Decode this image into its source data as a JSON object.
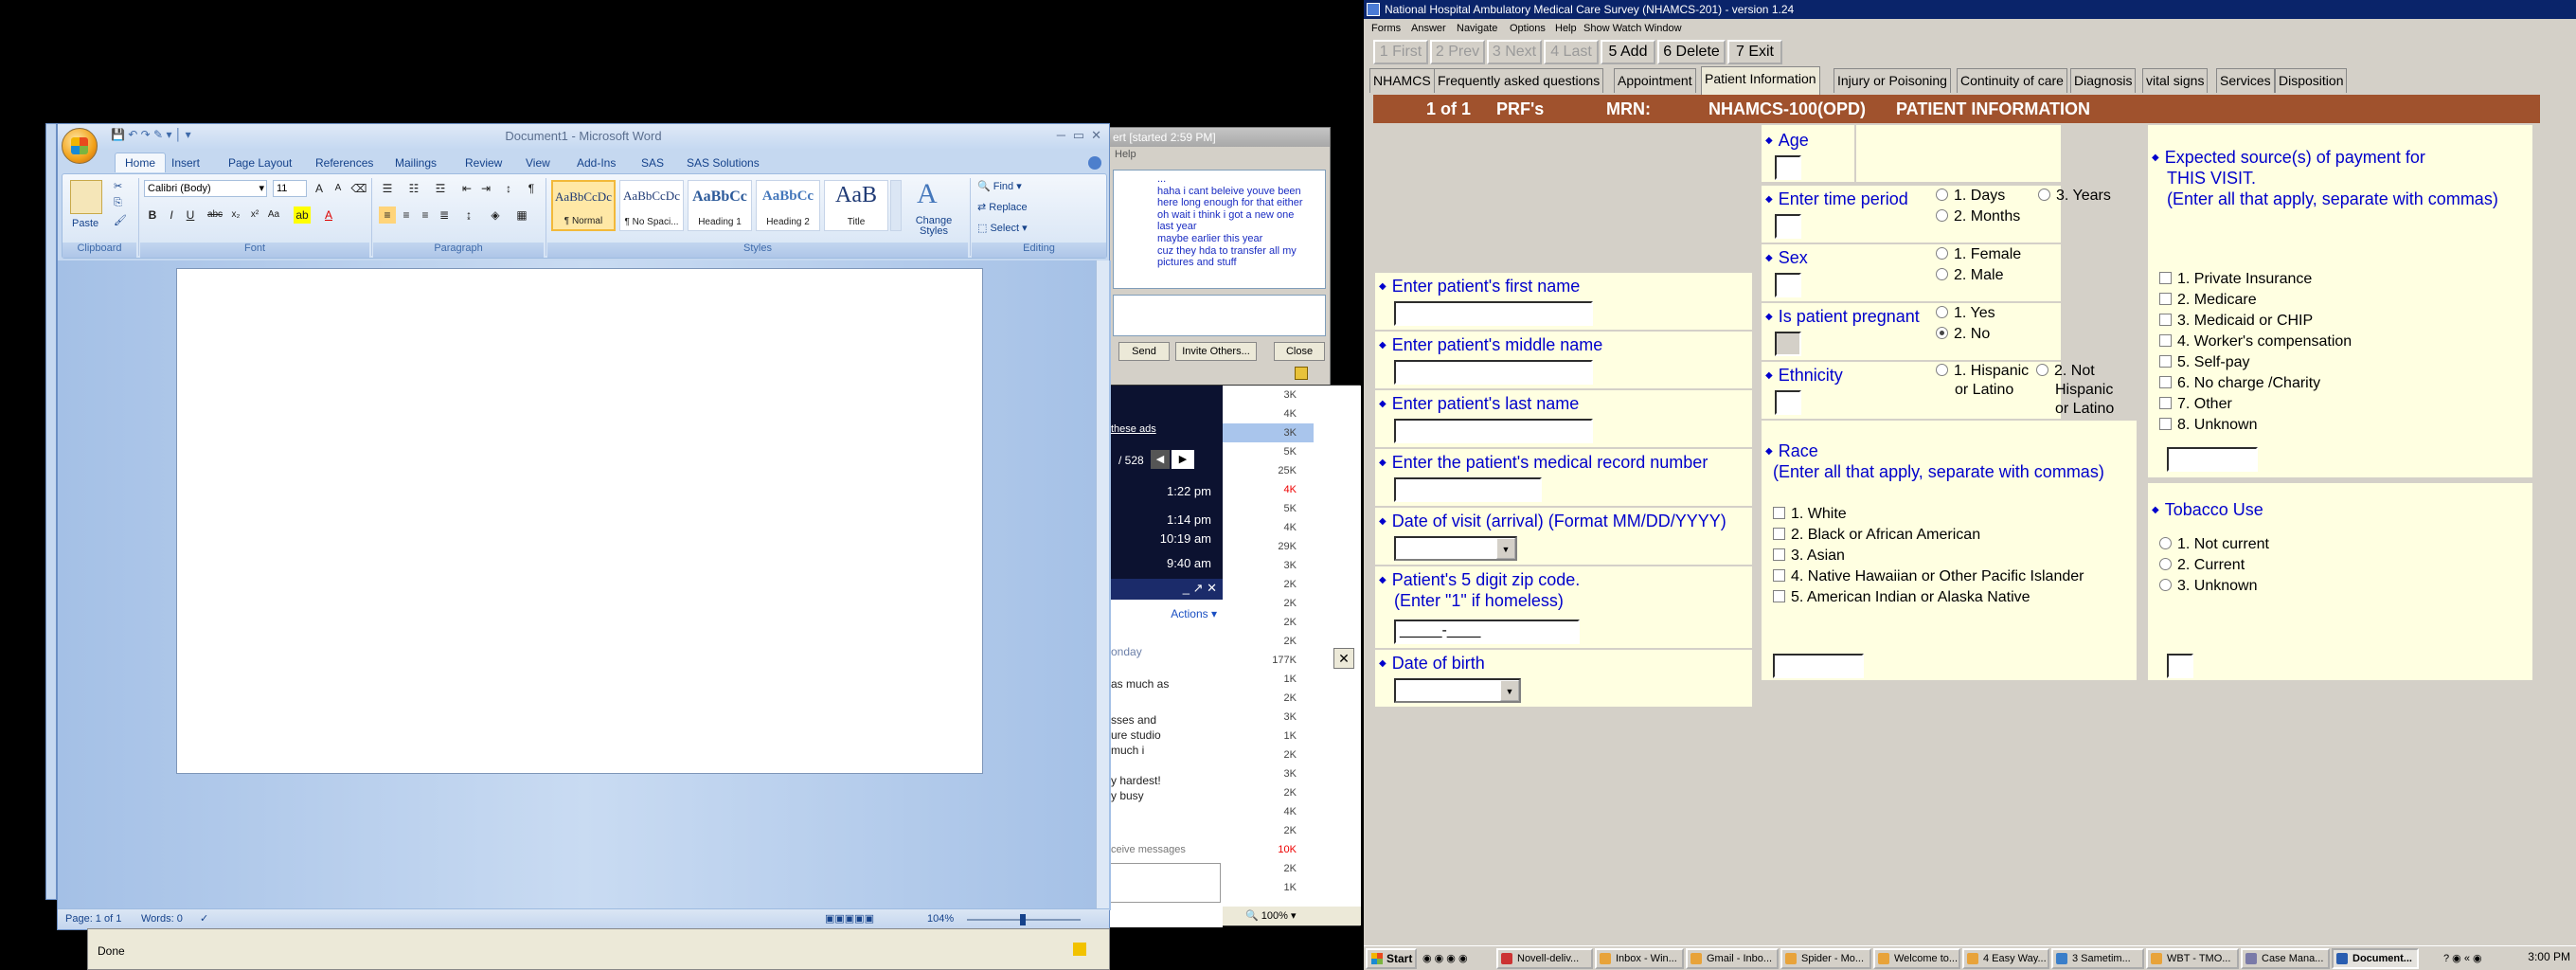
{
  "word": {
    "title": "Document1 - Microsoft Word",
    "tabs": [
      "Home",
      "Insert",
      "Page Layout",
      "References",
      "Mailings",
      "Review",
      "View",
      "Add-Ins",
      "SAS",
      "SAS Solutions"
    ],
    "font_name": "Calibri (Body)",
    "font_size": "11",
    "paste_label": "Paste",
    "groups": [
      "Clipboard",
      "Font",
      "Paragraph",
      "Styles",
      "Editing"
    ],
    "styles": [
      {
        "sample": "AaBbCcDc",
        "caption": "¶ Normal"
      },
      {
        "sample": "AaBbCcDc",
        "caption": "¶ No Spaci..."
      },
      {
        "sample": "AaBbCc",
        "caption": "Heading 1"
      },
      {
        "sample": "AaBbCc",
        "caption": "Heading 2"
      },
      {
        "sample": "AaB",
        "caption": "Title"
      }
    ],
    "change_styles": "Change Styles",
    "editing": {
      "find": "Find",
      "replace": "Replace",
      "select": "Select"
    },
    "status": {
      "page": "Page: 1 of 1",
      "words": "Words: 0",
      "zoom": "104%"
    }
  },
  "chat": {
    "title": "ert [started 2:59 PM]",
    "menu": "Help",
    "messages": [
      "...",
      "haha i cant beleive youve been",
      "here long enough for that either",
      "oh wait i think i got a new one",
      "last year",
      "maybe earlier this year",
      "cuz they hda to transfer all my",
      "pictures and stuff"
    ],
    "send": "Send",
    "invite": "Invite Others...",
    "close": "Close"
  },
  "mail": {
    "links": "these ads",
    "counter": "/ 528",
    "times": [
      "1:22 pm",
      "1:14 pm",
      "10:19 am",
      "9:40 am"
    ],
    "actions": "Actions",
    "snippets": [
      "onday",
      "as much as",
      "sses and",
      "ure studio",
      "much i",
      "y hardest!",
      "y busy",
      "ceive messages"
    ],
    "sizes": [
      {
        "v": "3K",
        "c": ""
      },
      {
        "v": "4K",
        "c": ""
      },
      {
        "v": "3K",
        "c": "sel"
      },
      {
        "v": "5K",
        "c": ""
      },
      {
        "v": "25K",
        "c": ""
      },
      {
        "v": "4K",
        "c": "red"
      },
      {
        "v": "5K",
        "c": ""
      },
      {
        "v": "4K",
        "c": ""
      },
      {
        "v": "29K",
        "c": ""
      },
      {
        "v": "3K",
        "c": ""
      },
      {
        "v": "2K",
        "c": ""
      },
      {
        "v": "2K",
        "c": ""
      },
      {
        "v": "2K",
        "c": ""
      },
      {
        "v": "2K",
        "c": ""
      },
      {
        "v": "177K",
        "c": ""
      },
      {
        "v": "1K",
        "c": ""
      },
      {
        "v": "2K",
        "c": ""
      },
      {
        "v": "3K",
        "c": ""
      },
      {
        "v": "1K",
        "c": ""
      },
      {
        "v": "2K",
        "c": ""
      },
      {
        "v": "3K",
        "c": ""
      },
      {
        "v": "2K",
        "c": ""
      },
      {
        "v": "4K",
        "c": ""
      },
      {
        "v": "2K",
        "c": ""
      },
      {
        "v": "10K",
        "c": "red"
      },
      {
        "v": "2K",
        "c": ""
      },
      {
        "v": "1K",
        "c": ""
      }
    ],
    "zoom": "100%"
  },
  "browser": {
    "status": "Done"
  },
  "app": {
    "title": "National Hospital Ambulatory Medical Care Survey (NHAMCS-201) - version 1.24",
    "menu": [
      "Forms",
      "Answer",
      "Navigate",
      "Options",
      "Help",
      "Show Watch Window"
    ],
    "nav": [
      "1 First",
      "2 Prev",
      "3 Next",
      "4 Last",
      "5 Add",
      "6 Delete",
      "7 Exit"
    ],
    "tabs": [
      "NHAMCS",
      "Frequently asked questions",
      "Appointment",
      "Patient Information",
      "Injury or Poisoning",
      "Continuity of care",
      "Diagnosis",
      "vital signs",
      "Services",
      "Disposition"
    ],
    "header": {
      "record": "1 of 1",
      "prf": "PRF's",
      "mrn": "MRN:",
      "form": "NHAMCS-100(OPD)",
      "section": "PATIENT INFORMATION"
    },
    "fields": {
      "first_name": "Enter patient's first name",
      "middle_name": "Enter patient's middle name",
      "last_name": "Enter patient's last name",
      "mrn": "Enter the patient's medical record number",
      "visit_date": "Date of visit (arrival) (Format MM/DD/YYYY)",
      "zip": "Patient's 5 digit zip code.",
      "zip_note": "(Enter \"1\" if homeless)",
      "zip_mask": "_____-____",
      "dob": "Date of birth",
      "age": "Age",
      "time_period": "Enter time period",
      "sex": "Sex",
      "pregnant": "Is patient pregnant",
      "ethnicity": "Ethnicity",
      "race": "Race",
      "race_note": "(Enter all that apply, separate with commas)",
      "payment": "Expected source(s) of payment for",
      "payment2": "THIS VISIT.",
      "payment3": "(Enter all that apply, separate with commas)",
      "tobacco": "Tobacco Use"
    },
    "time_opts": [
      "1. Days",
      "3. Years",
      "2. Months"
    ],
    "sex_opts": [
      "1. Female",
      "2. Male"
    ],
    "preg_opts": [
      "1. Yes",
      "2. No"
    ],
    "eth_opts": [
      "1. Hispanic",
      "or Latino",
      "2. Not",
      "Hispanic",
      "or Latino"
    ],
    "race_opts": [
      "1. White",
      "2. Black or African American",
      "3. Asian",
      "4. Native Hawaiian or Other Pacific Islander",
      "5. American Indian or Alaska Native"
    ],
    "payment_opts": [
      "1. Private Insurance",
      "2. Medicare",
      "3. Medicaid or CHIP",
      "4. Worker's compensation",
      "5. Self-pay",
      "6. No charge /Charity",
      "7. Other",
      "8. Unknown"
    ],
    "tobacco_opts": [
      "1. Not current",
      "2. Current",
      "3. Unknown"
    ]
  },
  "taskbar": {
    "start": "Start",
    "tasks": [
      "Novell-deliv...",
      "Inbox - Win...",
      "Gmail - Inbo...",
      "Spider - Mo...",
      "Welcome to...",
      "4 Easy Way...",
      "3 Sametim...",
      "WBT - TMO...",
      "Case Mana...",
      "Document..."
    ],
    "clock": "3:00 PM"
  }
}
